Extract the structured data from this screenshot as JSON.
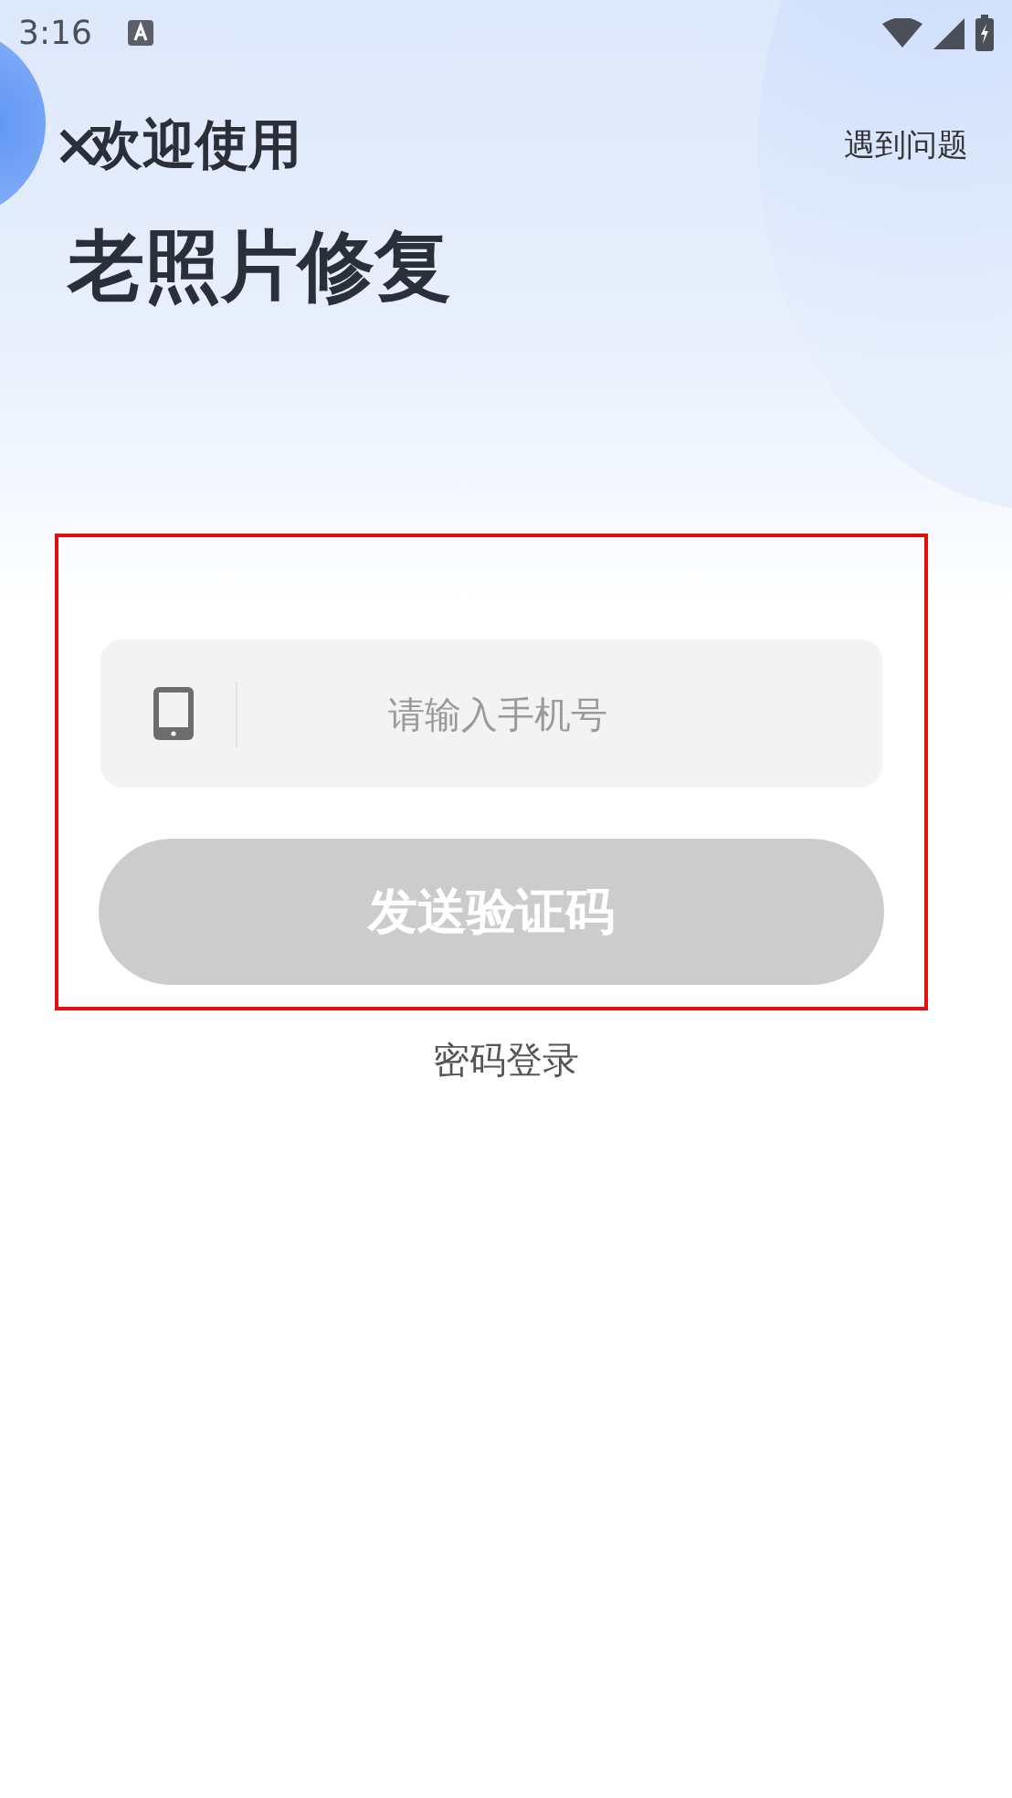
{
  "status_bar": {
    "time": "3:16"
  },
  "header": {
    "welcome": "欢迎使用",
    "app_name": "老照片修复",
    "help_link": "遇到问题"
  },
  "phone_field": {
    "placeholder": "请输入手机号"
  },
  "send_code_button": {
    "label": "发送验证码",
    "disabled": true
  },
  "password_login_link": "密码登录"
}
